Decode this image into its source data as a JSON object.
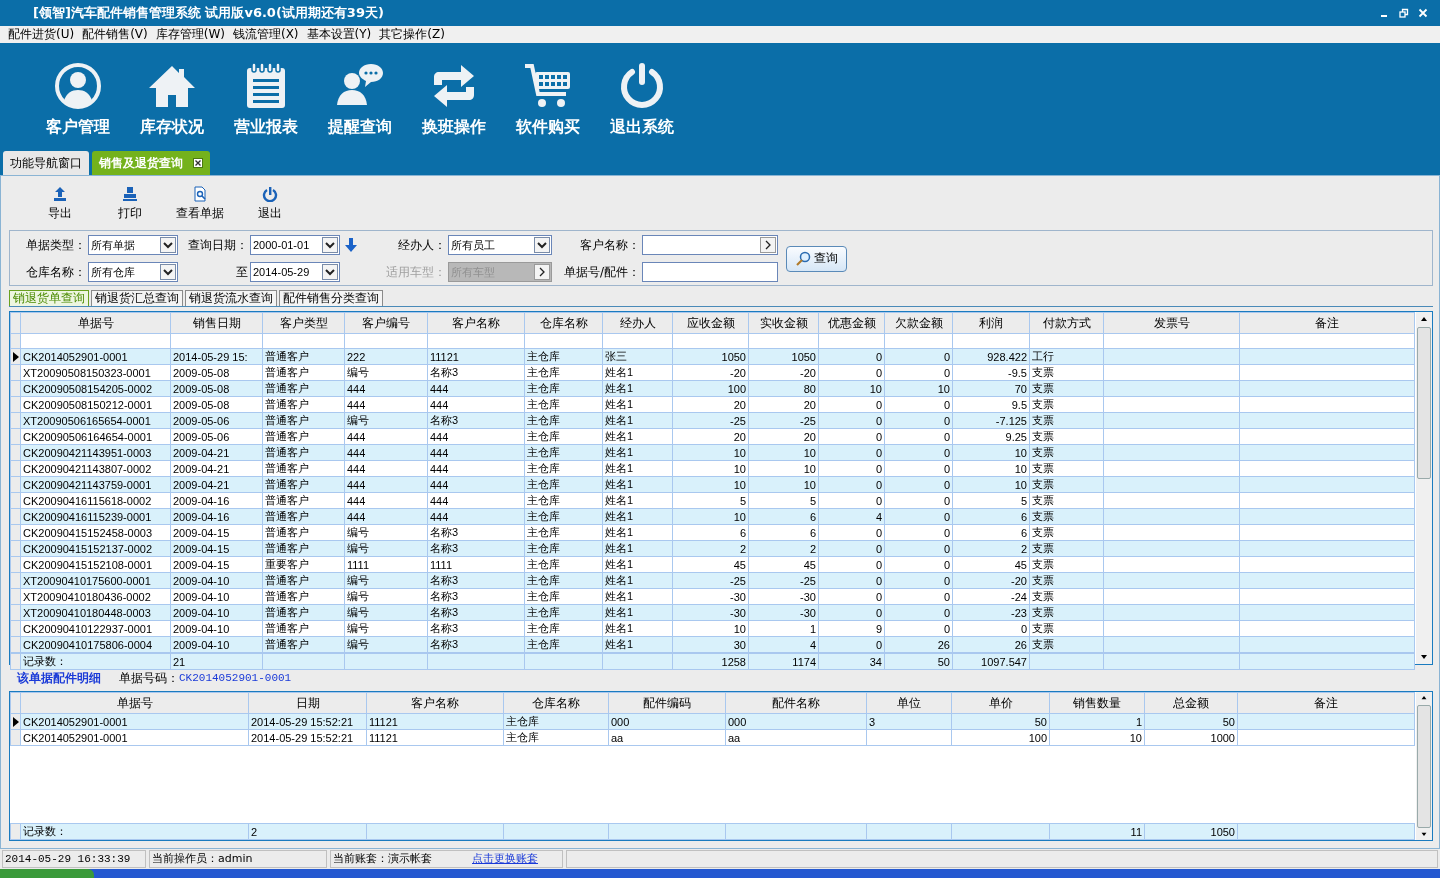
{
  "window": {
    "title": "[领智]汽车配件销售管理系统  试用版v6.0(试用期还有39天)"
  },
  "menu": [
    "配件进货(U)",
    "配件销售(V)",
    "库存管理(W)",
    "钱流管理(X)",
    "基本设置(Y)",
    "其它操作(Z)"
  ],
  "toolbar": [
    "客户管理",
    "库存状况",
    "营业报表",
    "提醒查询",
    "换班操作",
    "软件购买",
    "退出系统"
  ],
  "tabs": [
    {
      "label": "功能导航窗口",
      "selected": false,
      "closable": false
    },
    {
      "label": "销售及退货查询",
      "selected": true,
      "closable": true
    }
  ],
  "actions": [
    "导出",
    "打印",
    "查看单据",
    "退出"
  ],
  "filters": [
    {
      "label": "单据类型：",
      "value": "所有单据",
      "kind": "select",
      "disabled": false
    },
    {
      "label": "查询日期：",
      "value": "2000-01-01",
      "kind": "select",
      "disabled": false
    },
    {
      "label": "经办人：",
      "value": "所有员工",
      "kind": "select",
      "disabled": false
    },
    {
      "label": "客户名称：",
      "kind": "picker",
      "disabled": false
    },
    {
      "label": "仓库名称：",
      "value": "所有仓库",
      "kind": "select",
      "disabled": false
    },
    {
      "label": "至",
      "value": "2014-05-29",
      "kind": "select",
      "disabled": false
    },
    {
      "label": "适用车型：",
      "value": "所有车型",
      "kind": "picker",
      "disabled": true
    },
    {
      "label": "单据号/配件：",
      "kind": "text",
      "disabled": false
    }
  ],
  "query_button": "查询",
  "subtabs": [
    {
      "label": "销退货单查询",
      "selected": true
    },
    {
      "label": "销退货汇总查询",
      "selected": false
    },
    {
      "label": "销退货流水查询",
      "selected": false
    },
    {
      "label": "配件销售分类查询",
      "selected": false
    }
  ],
  "sales_table": {
    "columns": [
      "单据号",
      "销售日期",
      "客户类型",
      "客户编号",
      "客户名称",
      "仓库名称",
      "经办人",
      "应收金额",
      "实收金额",
      "优惠金额",
      "欠款金额",
      "利润",
      "付款方式",
      "发票号",
      "备注"
    ],
    "rows": [
      {
        "selected": true,
        "cells": [
          "CK2014052901-0001",
          "2014-05-29 15:",
          "普通客户",
          "222",
          "11121",
          "主仓库",
          "张三",
          "1050",
          "1050",
          "0",
          "0",
          "928.422",
          "工行"
        ]
      },
      {
        "selected": false,
        "cells": [
          "XT20090508150323-0001",
          "2009-05-08",
          "普通客户",
          "编号",
          "名称3",
          "主仓库",
          "姓名1",
          "-20",
          "-20",
          "0",
          "0",
          "-9.5",
          "支票"
        ]
      },
      {
        "selected": false,
        "cells": [
          "CK20090508154205-0002",
          "2009-05-08",
          "普通客户",
          "444",
          "444",
          "主仓库",
          "姓名1",
          "100",
          "80",
          "10",
          "10",
          "70",
          "支票"
        ]
      },
      {
        "selected": false,
        "cells": [
          "CK20090508150212-0001",
          "2009-05-08",
          "普通客户",
          "444",
          "444",
          "主仓库",
          "姓名1",
          "20",
          "20",
          "0",
          "0",
          "9.5",
          "支票"
        ]
      },
      {
        "selected": false,
        "cells": [
          "XT20090506165654-0001",
          "2009-05-06",
          "普通客户",
          "编号",
          "名称3",
          "主仓库",
          "姓名1",
          "-25",
          "-25",
          "0",
          "0",
          "-7.125",
          "支票"
        ]
      },
      {
        "selected": false,
        "cells": [
          "CK20090506164654-0001",
          "2009-05-06",
          "普通客户",
          "444",
          "444",
          "主仓库",
          "姓名1",
          "20",
          "20",
          "0",
          "0",
          "9.25",
          "支票"
        ]
      },
      {
        "selected": false,
        "cells": [
          "CK20090421143951-0003",
          "2009-04-21",
          "普通客户",
          "444",
          "444",
          "主仓库",
          "姓名1",
          "10",
          "10",
          "0",
          "0",
          "10",
          "支票"
        ]
      },
      {
        "selected": false,
        "cells": [
          "CK20090421143807-0002",
          "2009-04-21",
          "普通客户",
          "444",
          "444",
          "主仓库",
          "姓名1",
          "10",
          "10",
          "0",
          "0",
          "10",
          "支票"
        ]
      },
      {
        "selected": false,
        "cells": [
          "CK20090421143759-0001",
          "2009-04-21",
          "普通客户",
          "444",
          "444",
          "主仓库",
          "姓名1",
          "10",
          "10",
          "0",
          "0",
          "10",
          "支票"
        ]
      },
      {
        "selected": false,
        "cells": [
          "CK20090416115618-0002",
          "2009-04-16",
          "普通客户",
          "444",
          "444",
          "主仓库",
          "姓名1",
          "5",
          "5",
          "0",
          "0",
          "5",
          "支票"
        ]
      },
      {
        "selected": false,
        "cells": [
          "CK20090416115239-0001",
          "2009-04-16",
          "普通客户",
          "444",
          "444",
          "主仓库",
          "姓名1",
          "10",
          "6",
          "4",
          "0",
          "6",
          "支票"
        ]
      },
      {
        "selected": false,
        "cells": [
          "CK20090415152458-0003",
          "2009-04-15",
          "普通客户",
          "编号",
          "名称3",
          "主仓库",
          "姓名1",
          "6",
          "6",
          "0",
          "0",
          "6",
          "支票"
        ]
      },
      {
        "selected": false,
        "cells": [
          "CK20090415152137-0002",
          "2009-04-15",
          "普通客户",
          "编号",
          "名称3",
          "主仓库",
          "姓名1",
          "2",
          "2",
          "0",
          "0",
          "2",
          "支票"
        ]
      },
      {
        "selected": false,
        "cells": [
          "CK20090415152108-0001",
          "2009-04-15",
          "重要客户",
          "1111",
          "1111",
          "主仓库",
          "姓名1",
          "45",
          "45",
          "0",
          "0",
          "45",
          "支票"
        ]
      },
      {
        "selected": false,
        "cells": [
          "XT20090410175600-0001",
          "2009-04-10",
          "普通客户",
          "编号",
          "名称3",
          "主仓库",
          "姓名1",
          "-25",
          "-25",
          "0",
          "0",
          "-20",
          "支票"
        ]
      },
      {
        "selected": false,
        "cells": [
          "XT20090410180436-0002",
          "2009-04-10",
          "普通客户",
          "编号",
          "名称3",
          "主仓库",
          "姓名1",
          "-30",
          "-30",
          "0",
          "0",
          "-24",
          "支票"
        ]
      },
      {
        "selected": false,
        "cells": [
          "XT20090410180448-0003",
          "2009-04-10",
          "普通客户",
          "编号",
          "名称3",
          "主仓库",
          "姓名1",
          "-30",
          "-30",
          "0",
          "0",
          "-23",
          "支票"
        ]
      },
      {
        "selected": false,
        "cells": [
          "CK20090410122937-0001",
          "2009-04-10",
          "普通客户",
          "编号",
          "名称3",
          "主仓库",
          "姓名1",
          "10",
          "1",
          "9",
          "0",
          "0",
          "支票"
        ]
      },
      {
        "selected": false,
        "cells": [
          "CK20090410175806-0004",
          "2009-04-10",
          "普通客户",
          "编号",
          "名称3",
          "主仓库",
          "姓名1",
          "30",
          "4",
          "0",
          "26",
          "26",
          "支票"
        ]
      }
    ],
    "total": {
      "label": "记录数：",
      "count": "21",
      "sums": [
        "1258",
        "1174",
        "34",
        "50",
        "1097.547"
      ]
    }
  },
  "detail": {
    "title": "该单据配件明细",
    "doc_label": "单据号码：",
    "doc_number": "CK2014052901-0001",
    "table": {
      "columns": [
        "单据号",
        "日期",
        "客户名称",
        "仓库名称",
        "配件编码",
        "配件名称",
        "单位",
        "单价",
        "销售数量",
        "总金额",
        "备注"
      ],
      "rows": [
        {
          "selected": true,
          "doc_no": "CK2014052901-0001",
          "date": "2014-05-29 15:52:21",
          "customer": "11121",
          "warehouse": "主仓库",
          "part_code": "000",
          "part_name": "000",
          "unit": "3",
          "price": "50",
          "quantity": "1",
          "amount": "50"
        },
        {
          "selected": false,
          "doc_no": "CK2014052901-0001",
          "date": "2014-05-29 15:52:21",
          "customer": "11121",
          "warehouse": "主仓库",
          "part_code": "aa",
          "part_name": "aa",
          "price": "100",
          "quantity": "10",
          "amount": "1000"
        }
      ],
      "total": {
        "label": "记录数：",
        "count": "2",
        "sums": [
          "11",
          "1050"
        ]
      }
    }
  },
  "status_bar": {
    "datetime": "2014-05-29 16:33:39",
    "operator": "当前操作员：admin",
    "account": "当前账套：演示帐套",
    "link": "点击更换账套"
  }
}
